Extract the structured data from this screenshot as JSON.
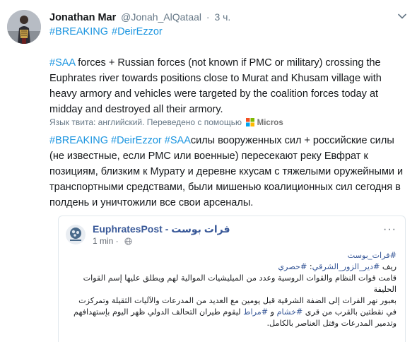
{
  "tweet": {
    "display_name": "Jonathan Mar",
    "handle": "@Jonah_AlQataal",
    "dot": "·",
    "time": "3 ч.",
    "header_tags": [
      "#BREAKING",
      "#DeirEzzor"
    ],
    "body_tag": "#SAA",
    "body_text": " forces + Russian forces (not known if PMC or military) crossing the Euphrates river towards positions close to Murat and Khusam village with heavy armory and vehicles were targeted by the coalition forces today at midday and destroyed all their armory.",
    "translation_note": "Язык твита: английский. Переведено с помощью",
    "translation_provider": "Micros",
    "translated_tags": [
      "#BREAKING",
      "#DeirEzzor",
      "#SAA"
    ],
    "translated_text": "силы вооруженных сил + российские силы (не известные, если PMC или военные) пересекают реку Евфрат к позициям, близким к Мурату и деревне кхусам с тяжелыми оружейными и транспортными средствами, были мишенью коалиционных сил сегодня в полдень и уничтожили все свои арсеналы."
  },
  "card": {
    "page_name": "EuphratesPost - فرات بوست",
    "time": "1 min ·",
    "more": "···",
    "lines": [
      {
        "tag": "#فرات_بوست",
        "text": ""
      },
      {
        "tag": "",
        "text": "ريف ",
        "tag2": "#دير_الزور_الشرقي",
        "text2": ": ",
        "tag3": "#حصري"
      },
      {
        "text": "قامت قوات النظام والقوات الروسية وعدد من الميليشيات الموالية لهم ويطلق عليها إسم القوات الحليفة"
      },
      {
        "text": "بعبور نهر الفرات إلى الضفة الشرقية قبل يومين مع العديد من المدرعات والآليات الثقيلة وتمركزت"
      },
      {
        "text": "في نقطتين بالقرب من قرى ",
        "tag": "#خشام",
        "text2": " و ",
        "tag2": "#مراط",
        "text3": " ليقوم طيران التحالف الدولي ظهر اليوم بإستهدافهم"
      },
      {
        "text": "وتدمير المدرعات وقتل العناصر بالكامل."
      }
    ]
  },
  "colors": {
    "link": "#1b95e0",
    "fb_link": "#385898",
    "muted": "#657786"
  }
}
